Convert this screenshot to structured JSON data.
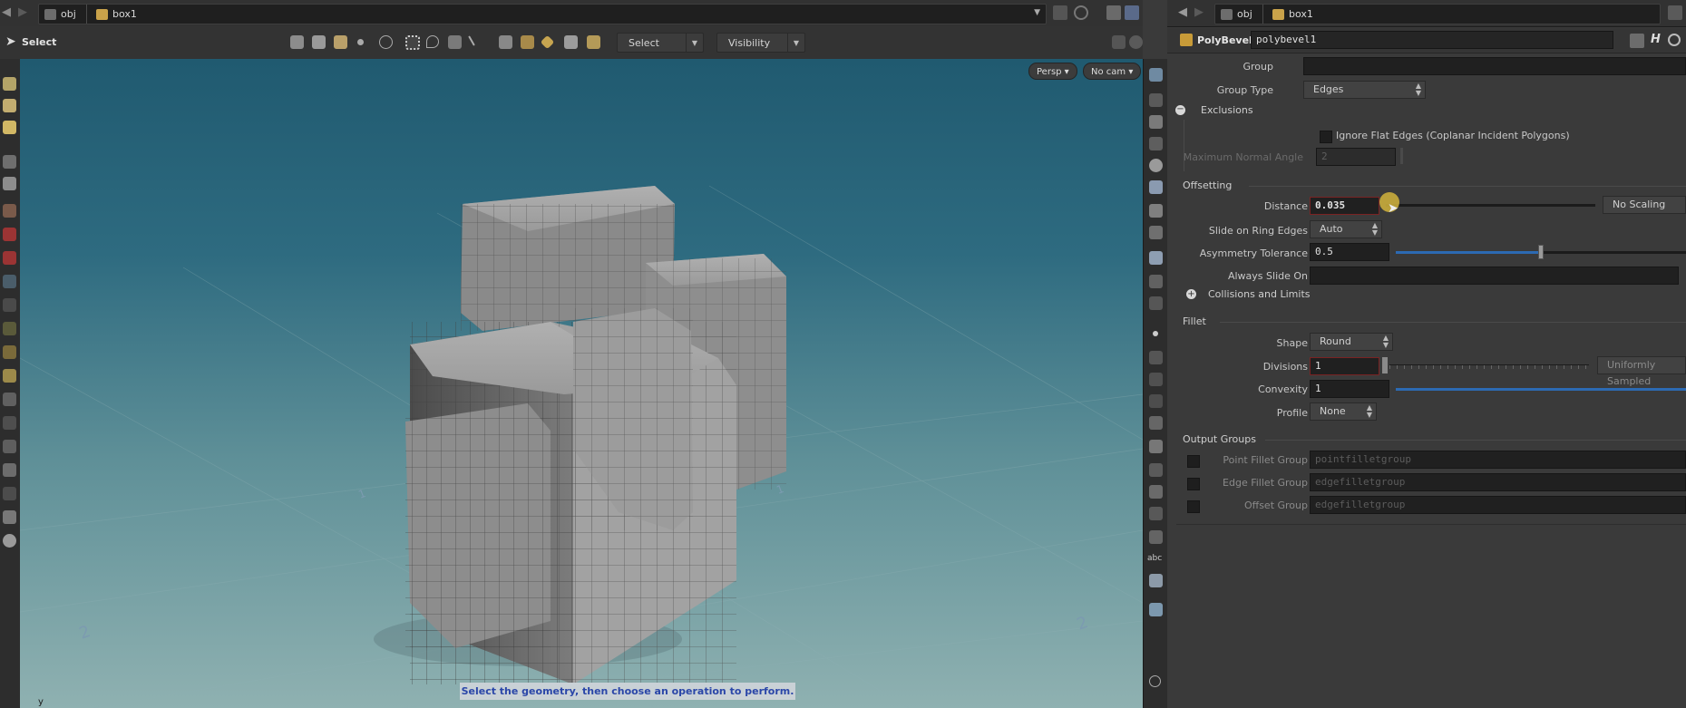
{
  "left_path": {
    "network": "obj",
    "node": "box1"
  },
  "viewer": {
    "tool_label": "Select",
    "select_dropdown": "Select",
    "visibility_dropdown": "Visibility",
    "persp_button": "Persp ▾",
    "cam_button": "No cam ▾",
    "status_message": "Select the geometry, then choose an operation to perform.",
    "axis_label": "y",
    "grid_labels": [
      "1",
      "2",
      "1",
      "2"
    ],
    "colors": {
      "viewport_top": "#205a70",
      "viewport_bottom": "#8fb1b1",
      "status_text": "#2a46a8"
    }
  },
  "right_path": {
    "network": "obj",
    "node": "box1"
  },
  "node": {
    "type": "PolyBevel",
    "name": "polybevel1"
  },
  "params": {
    "group": {
      "label": "Group",
      "value": ""
    },
    "group_type": {
      "label": "Group Type",
      "value": "Edges"
    },
    "exclusions": {
      "label": "Exclusions",
      "ignore_flat": {
        "label": "Ignore Flat Edges (Coplanar Incident Polygons)",
        "checked": false
      },
      "max_normal_angle": {
        "label": "Maximum Normal Angle",
        "value": "2"
      }
    },
    "offsetting": {
      "label": "Offsetting",
      "distance": {
        "label": "Distance",
        "value": "0.035",
        "scaling": "No Scaling"
      },
      "slide_ring": {
        "label": "Slide on Ring Edges",
        "value": "Auto"
      },
      "asym_tol": {
        "label": "Asymmetry Tolerance",
        "value": "0.5",
        "level": 0.5
      },
      "always_slide": {
        "label": "Always Slide On",
        "value": ""
      },
      "collisions": {
        "label": "Collisions and Limits"
      }
    },
    "fillet": {
      "label": "Fillet",
      "shape": {
        "label": "Shape",
        "value": "Round"
      },
      "divisions": {
        "label": "Divisions",
        "value": "1",
        "mode": "Uniformly Sampled"
      },
      "convexity": {
        "label": "Convexity",
        "value": "1"
      },
      "profile": {
        "label": "Profile",
        "value": "None"
      }
    },
    "output_groups": {
      "label": "Output Groups",
      "point_fillet": {
        "label": "Point Fillet Group",
        "placeholder": "pointfilletgroup"
      },
      "edge_fillet": {
        "label": "Edge Fillet Group",
        "placeholder": "edgefilletgroup"
      },
      "offset": {
        "label": "Offset Group",
        "placeholder": "edgefilletgroup"
      }
    }
  },
  "right_shelf_text": "abc"
}
